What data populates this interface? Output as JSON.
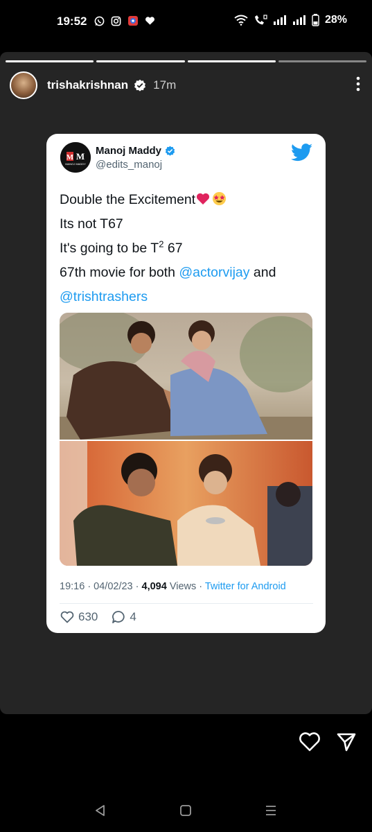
{
  "status_bar": {
    "time": "19:52",
    "battery": "28%",
    "left_icons": [
      "whatsapp-icon",
      "instagram-icon",
      "app-icon",
      "heart-icon"
    ],
    "right_icons": [
      "wifi-icon",
      "call-icon",
      "signal-icon",
      "signal-icon",
      "battery-icon"
    ]
  },
  "story": {
    "username": "trishakrishnan",
    "time_ago": "17m",
    "progress_segments_total": 4,
    "progress_current": 4
  },
  "tweet": {
    "name": "Manoj Maddy",
    "handle": "@edits_manoj",
    "avatar_text": "M M",
    "avatar_subtext": "MANOJ MADDY",
    "line1": "Double the Excitement",
    "line1_emojis": [
      "red-heart-emoji",
      "star-struck-emoji"
    ],
    "line2": "Its not T67",
    "line3_pre": "It's going to be T",
    "line3_sup": "2",
    "line3_post": " 67",
    "line4_pre": "67th movie for both ",
    "mention1": "@actorvijay",
    "line4_post": " and",
    "mention2": "@trishtrashers",
    "timestamp": "19:16 · 04/02/23 · ",
    "views_count": "4,094",
    "views_label": " Views · ",
    "source": "Twitter for Android",
    "likes": "630",
    "replies": "4"
  },
  "colors": {
    "twitter_blue": "#1d9bf0",
    "story_bg": "#252525",
    "card_bg": "#ffffff"
  }
}
